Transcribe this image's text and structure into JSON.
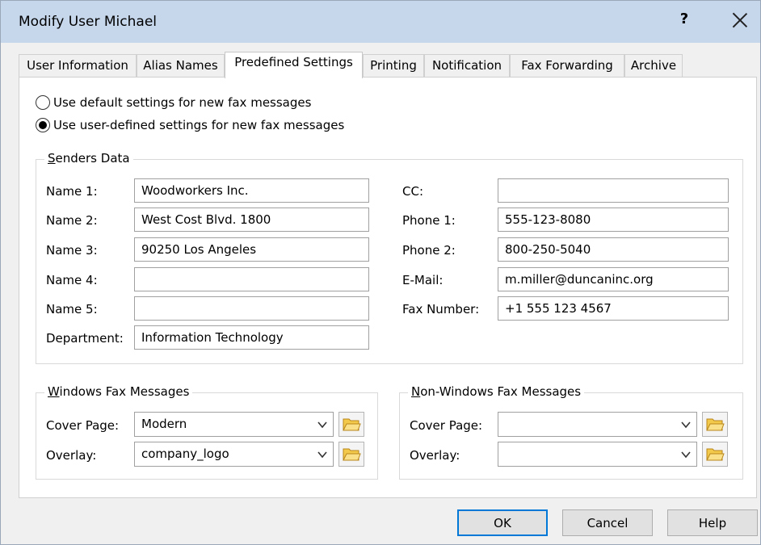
{
  "window": {
    "title": "Modify User Michael",
    "help_label": "?"
  },
  "tabs": [
    {
      "label": "User Information"
    },
    {
      "label": "Alias Names"
    },
    {
      "label": "Predefined Settings"
    },
    {
      "label": "Printing"
    },
    {
      "label": "Notification"
    },
    {
      "label": "Fax Forwarding"
    },
    {
      "label": "Archive"
    }
  ],
  "active_tab": "Predefined Settings",
  "options": {
    "default_label": "Use default settings for new fax messages",
    "user_defined_label": "Use user-defined settings for new fax messages",
    "selected": "user_defined"
  },
  "senders": {
    "title_key": "S",
    "title_rest": "enders Data",
    "name1": {
      "label": "Name 1:",
      "value": "Woodworkers Inc."
    },
    "name2": {
      "label": "Name 2:",
      "value": "West Cost Blvd. 1800"
    },
    "name3": {
      "label": "Name 3:",
      "value": "90250 Los Angeles"
    },
    "name4": {
      "label": "Name 4:",
      "value": ""
    },
    "name5": {
      "label": "Name 5:",
      "value": ""
    },
    "department": {
      "label": "Department:",
      "value": "Information Technology"
    },
    "cc": {
      "label": "CC:",
      "value": ""
    },
    "phone1": {
      "label": "Phone 1:",
      "value": "555-123-8080"
    },
    "phone2": {
      "label": "Phone 2:",
      "value": "800-250-5040"
    },
    "email": {
      "label": "E-Mail:",
      "value": "m.miller@duncaninc.org"
    },
    "fax": {
      "label": "Fax Number:",
      "value": "+1 555 123 4567"
    }
  },
  "windows_fax": {
    "title_key": "W",
    "title_rest": "indows Fax Messages",
    "cover_page": {
      "label": "Cover Page:",
      "value": "Modern"
    },
    "overlay": {
      "label": "Overlay:",
      "value": "company_logo"
    }
  },
  "non_windows_fax": {
    "title_key": "N",
    "title_rest": "on-Windows Fax Messages",
    "cover_page": {
      "label": "Cover Page:",
      "value": ""
    },
    "overlay": {
      "label": "Overlay:",
      "value": ""
    }
  },
  "buttons": {
    "ok": "OK",
    "cancel": "Cancel",
    "help": "Help"
  },
  "icons": {
    "folder": "folder-open-icon",
    "chevron": "chevron-down-icon",
    "close": "close-icon"
  },
  "colors": {
    "titlebar": "#c6d7ec",
    "folder": "#f3c94b",
    "default_button_border": "#0078d7"
  }
}
